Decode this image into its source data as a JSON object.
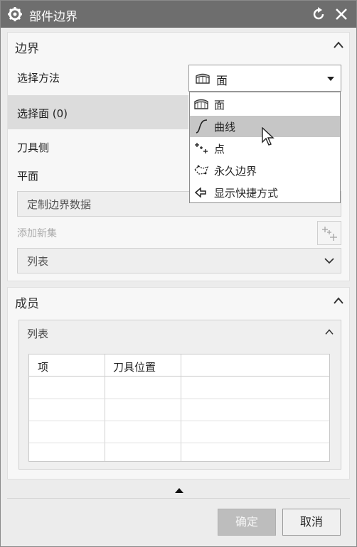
{
  "window": {
    "title": "部件边界",
    "reset_icon": "reset-icon",
    "close_icon": "close-icon"
  },
  "boundary_section": {
    "title": "边界",
    "select_method_label": "选择方法",
    "select_method_value": "面",
    "select_face_label": "选择面 (0)",
    "tool_side_label": "刀具侧",
    "plane_label": "平面",
    "custom_boundary_data": "定制边界数据",
    "add_new_set_label": "添加新集",
    "list_label": "列表"
  },
  "dropdown": {
    "items": [
      {
        "label": "面",
        "icon": "face-icon"
      },
      {
        "label": "曲线",
        "icon": "curve-icon"
      },
      {
        "label": "点",
        "icon": "points-icon"
      },
      {
        "label": "永久边界",
        "icon": "permanent-boundary-icon"
      },
      {
        "label": "显示快捷方式",
        "icon": "shortcut-icon"
      }
    ],
    "highlighted_index": 1
  },
  "members_section": {
    "title": "成员",
    "list_title": "列表",
    "columns": [
      "项",
      "刀具位置"
    ]
  },
  "footer": {
    "ok_label": "确定",
    "cancel_label": "取消"
  }
}
